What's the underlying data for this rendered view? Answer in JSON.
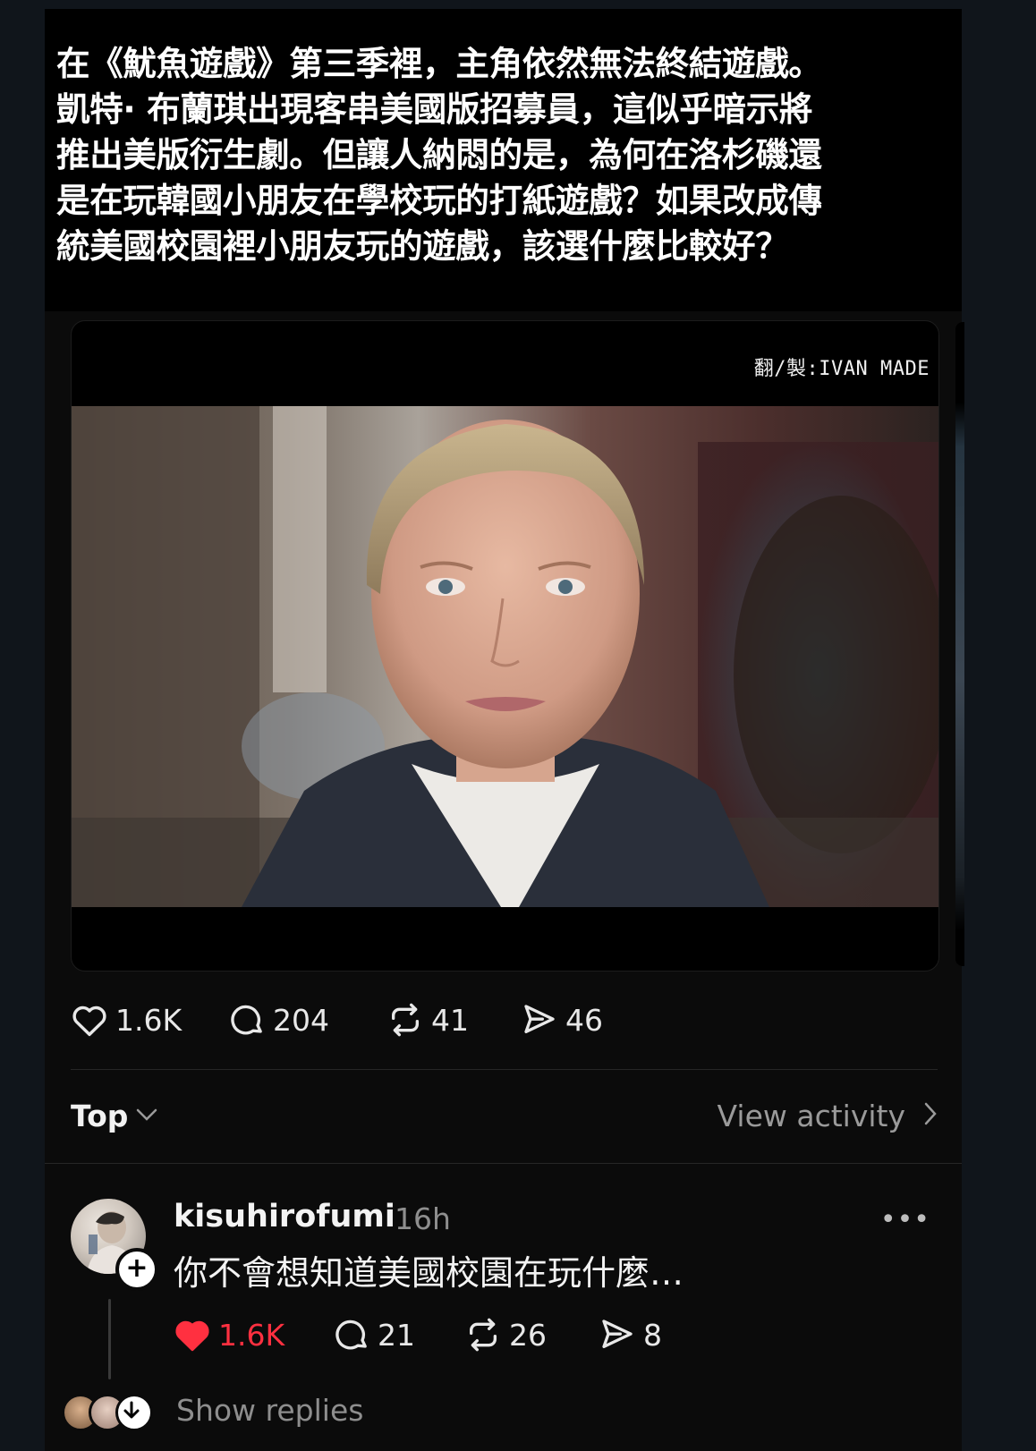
{
  "post": {
    "caption": "在《魷魚遊戲》第三季裡，主角依然無法終結遊戲。\n凱特· 布蘭琪出現客串美國版招募員，這似乎暗示將\n推出美版衍生劇。但讓人納悶的是，為何在洛杉磯還\n是在玩韓國小朋友在學校玩的打紙遊戲？如果改成傳\n統美國校園裡小朋友玩的遊戲，該選什麼比較好？",
    "video_watermark": "翻/製:IVAN MADE",
    "actions": {
      "likes": "1.6K",
      "comments": "204",
      "reposts": "41",
      "shares": "46"
    }
  },
  "replies_header": {
    "sort_label": "Top",
    "view_activity": "View activity"
  },
  "comment": {
    "username": "kisuhirofumi",
    "time": "16h",
    "text": "你不會想知道美國校園在玩什麼…",
    "follow_symbol": "+",
    "more_symbol": "•••",
    "actions": {
      "likes": "1.6K",
      "comments": "21",
      "reposts": "26",
      "shares": "8"
    },
    "liked": true,
    "show_replies": "Show replies"
  },
  "colors": {
    "like_red": "#ff3040",
    "muted_text": "#8e8e8e"
  },
  "icons": [
    "heart-icon",
    "comment-icon",
    "repost-icon",
    "share-icon",
    "chevron-down-icon",
    "chevron-right-icon",
    "more-icon",
    "plus-icon",
    "arrow-down-icon"
  ]
}
